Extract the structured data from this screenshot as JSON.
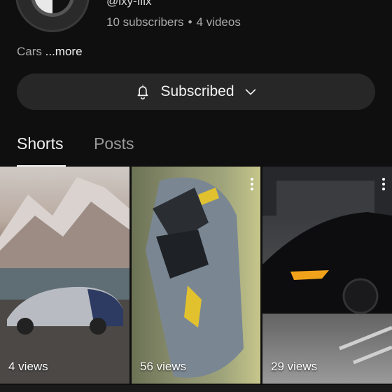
{
  "channel": {
    "handle": "@ixy-flix",
    "subscribers": "10 subscribers",
    "separator": "•",
    "videos": "4 videos",
    "description": "Cars",
    "more_label": "...more"
  },
  "subscribe_button": {
    "label": "Subscribed",
    "icon": "bell-icon",
    "dropdown_icon": "chevron-down-icon"
  },
  "tabs": [
    {
      "label": "Shorts",
      "active": true
    },
    {
      "label": "Posts",
      "active": false
    }
  ],
  "shorts": [
    {
      "views": "4 views",
      "thumbnail": "silver-blue hypercar in front of snowy mountains"
    },
    {
      "views": "56 views",
      "thumbnail": "grey supercar front view with yellow accents"
    },
    {
      "views": "29 views",
      "thumbnail": "black sports coupe in parking garage"
    }
  ],
  "colors": {
    "background": "#0f0f0f",
    "button_bg": "#272727",
    "text_primary": "#f1f1f1",
    "text_secondary": "#aaaaaa"
  }
}
